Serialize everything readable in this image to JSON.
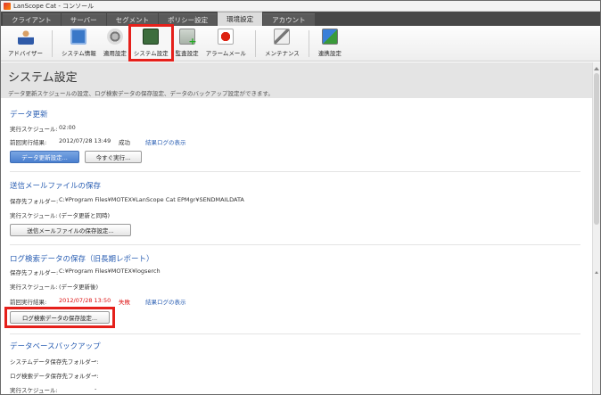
{
  "window": {
    "title": "LanScope Cat - コンソール"
  },
  "tabs": [
    "クライアント",
    "サーバー",
    "セグメント",
    "ポリシー設定",
    "環境設定",
    "アカウント"
  ],
  "active_tab": "環境設定",
  "toolbar": [
    {
      "label": "アドバイザー",
      "icon": "advisor-user-icon"
    },
    {
      "label": "システム情報",
      "icon": "system-info-icon"
    },
    {
      "label": "適用設定",
      "icon": "apply-settings-gear-icon"
    },
    {
      "label": "システム設定",
      "icon": "system-settings-server-icon",
      "selected": true
    },
    {
      "label": "監査設定",
      "icon": "audit-settings-icon"
    },
    {
      "label": "アラームメール",
      "icon": "alarm-mail-icon"
    },
    {
      "label": "メンテナンス",
      "icon": "maintenance-tools-icon"
    },
    {
      "label": "連携設定",
      "icon": "integration-settings-icon"
    }
  ],
  "header": {
    "title": "システム設定",
    "description": "データ更新スケジュールの設定、ログ検索データの保存設定、データのバックアップ設定ができます。"
  },
  "data_update": {
    "title": "データ更新",
    "schedule_label": "実行スケジュール:",
    "schedule_value": "02:00",
    "last_label": "前回実行結果:",
    "last_value": "2012/07/28 13:49",
    "last_status": "成功",
    "log_link": "結果ログの表示",
    "settings_button": "データ更新設定...",
    "run_button": "今すぐ実行..."
  },
  "mail_save": {
    "title": "送信メールファイルの保存",
    "folder_label": "保存先フォルダー:",
    "folder_value": "C:¥Program Files¥MOTEX¥LanScope Cat EPMgr¥SENDMAILDATA",
    "schedule_label": "実行スケジュール:",
    "schedule_value": "(データ更新と同時)",
    "button": "送信メールファイルの保存設定..."
  },
  "log_save": {
    "title": "ログ検索データの保存（旧長期レポート）",
    "folder_label": "保存先フォルダー:",
    "folder_value": "C:¥Program Files¥MOTEX¥logserch",
    "schedule_label": "実行スケジュール:",
    "schedule_value": "(データ更新後)",
    "last_label": "前回実行結果:",
    "last_value": "2012/07/28 13:50",
    "last_status": "失敗",
    "log_link": "結果ログの表示",
    "button": "ログ検索データの保存設定..."
  },
  "db_backup": {
    "title": "データベースバックアップ",
    "sys_folder_label": "システムデータ保存先フォルダー:",
    "sys_folder_value": "-",
    "log_folder_label": "ログ検索データ保存先フォルダー:",
    "log_folder_value": "-",
    "schedule_label": "実行スケジュール:",
    "schedule_value": "-"
  },
  "colors": {
    "accent": "#2b5fb3",
    "highlight": "#e5201b",
    "fail": "#dd1111"
  }
}
